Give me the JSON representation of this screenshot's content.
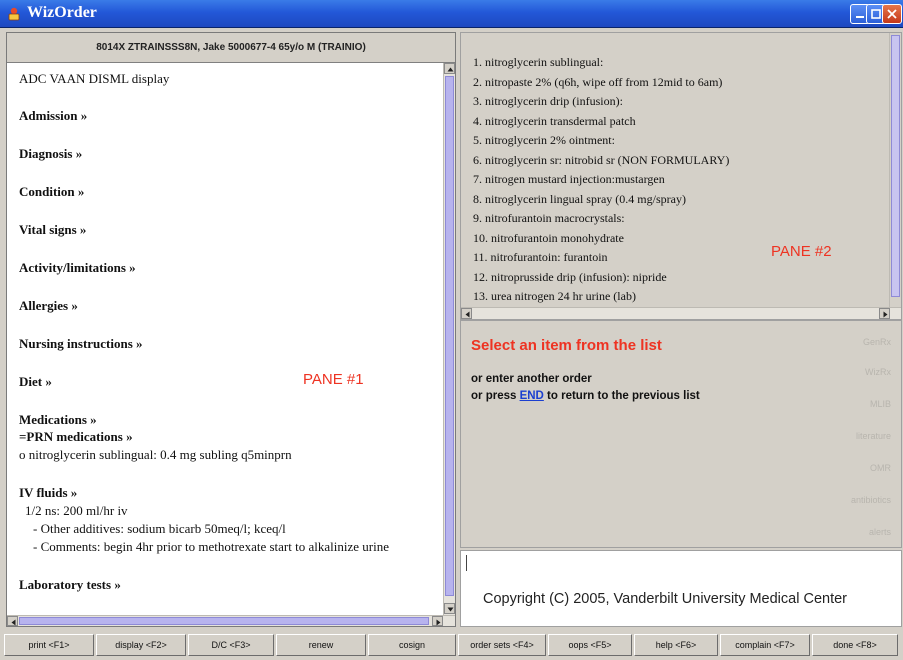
{
  "window": {
    "title": "WizOrder",
    "colors": {
      "titlebar": "#2358d8",
      "pane_label": "#ee3322",
      "thumb": "#b7b3ee"
    }
  },
  "patient_header": "8014X ZTRAINSSS8N, Jake 5000677-4 65y/o M (TRAINIO)",
  "left_pane": {
    "label": "PANE #1",
    "title": "ADC VAAN DISML display",
    "sections": {
      "admission": "Admission »",
      "diagnosis": "Diagnosis »",
      "condition": "Condition »",
      "vital_signs": "Vital signs »",
      "activity": "Activity/limitations »",
      "allergies": "Allergies »",
      "nursing": "Nursing instructions »",
      "diet": "Diet »",
      "medications": "Medications »",
      "prn": "=PRN medications »",
      "iv_fluids": "IV fluids »",
      "lab_tests": "Laboratory tests »"
    },
    "med_order": "o nitroglycerin sublingual:  0.4 mg subling q5minprn",
    "iv_order": "1/2 ns:  200 ml/hr iv",
    "iv_additives": "- Other additives: sodium bicarb 50meq/l; kceq/l",
    "iv_comments": "- Comments: begin 4hr prior to methotrexate start to alkalinize urine"
  },
  "right_list": {
    "label": "PANE #2",
    "items": [
      "1. nitroglycerin sublingual:",
      "2. nitropaste 2% (q6h, wipe off from 12mid to 6am)",
      "3. nitroglycerin drip (infusion):",
      "4. nitroglycerin transdermal patch",
      "5. nitroglycerin 2% ointment:",
      "6. nitroglycerin sr: nitrobid sr (NON FORMULARY)",
      "7. nitrogen mustard injection:mustargen",
      "8. nitroglycerin lingual spray (0.4 mg/spray)",
      "9. nitrofurantoin macrocrystals:",
      "10. nitrofurantoin monohydrate",
      "11. nitrofurantoin: furantoin",
      "12. nitroprusside drip (infusion): nipride",
      "13. urea nitrogen 24 hr urine (lab)"
    ]
  },
  "prompt": {
    "heading": "Select an item from the list",
    "line1": "or enter another order",
    "line2_before": "or press ",
    "line2_link": "END",
    "line2_after": " to return to the previous list",
    "side_links": [
      "GenRx",
      "WizRx",
      "MLIB",
      "literature",
      "OMR",
      "antibiotics",
      "alerts"
    ]
  },
  "copyright": "Copyright (C) 2005, Vanderbilt University Medical Center",
  "function_keys": [
    {
      "name": "print",
      "label": "print  <F1>"
    },
    {
      "name": "display",
      "label": "display  <F2>"
    },
    {
      "name": "dc",
      "label": "D/C  <F3>"
    },
    {
      "name": "renew",
      "label": "renew"
    },
    {
      "name": "cosign",
      "label": "cosign"
    },
    {
      "name": "order-sets",
      "label": "order sets <F4>"
    },
    {
      "name": "oops",
      "label": "oops  <F5>"
    },
    {
      "name": "help",
      "label": "help  <F6>"
    },
    {
      "name": "complain",
      "label": "complain <F7>"
    },
    {
      "name": "done",
      "label": "done  <F8>"
    }
  ]
}
